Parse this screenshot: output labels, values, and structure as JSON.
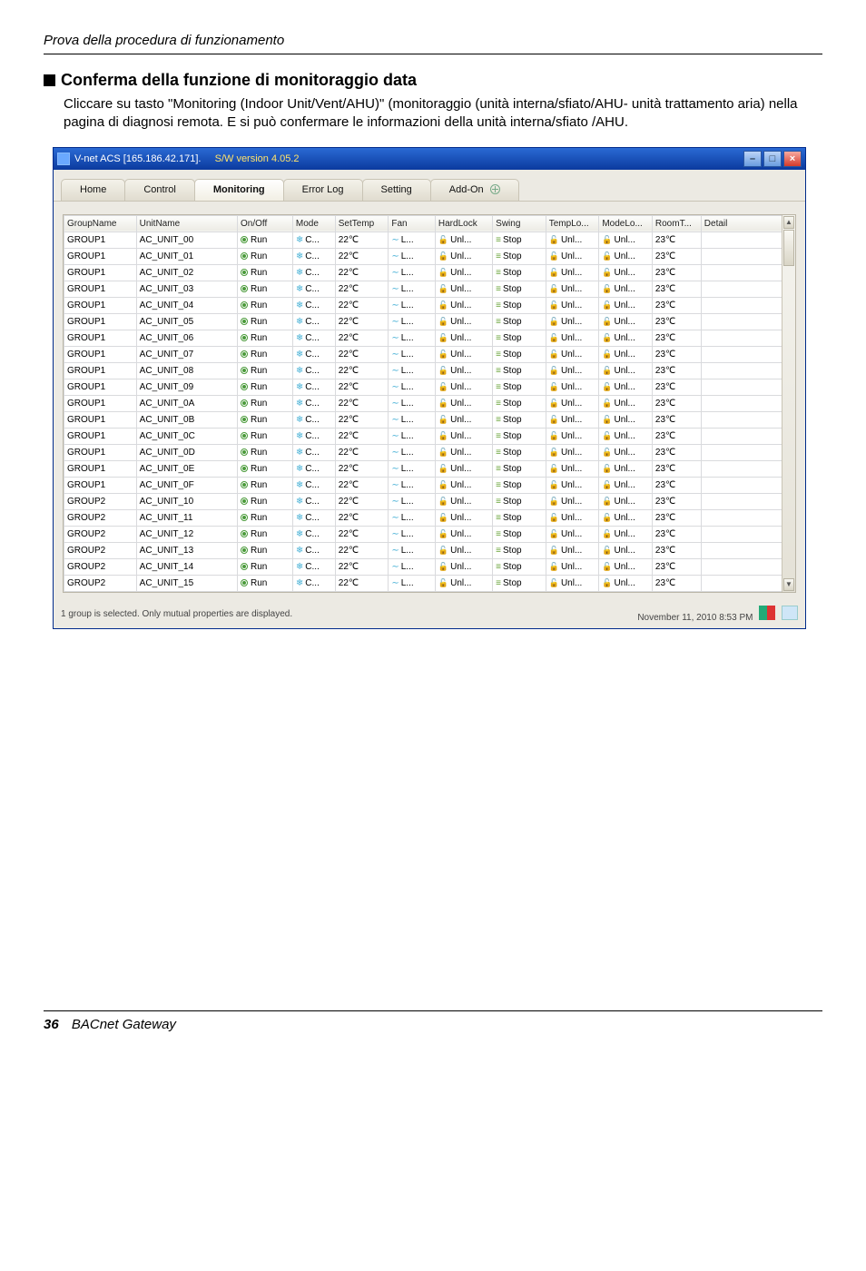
{
  "header": "Prova della procedura di funzionamento",
  "section_title": "Conferma della funzione di monitoraggio data",
  "body_text": "Cliccare su tasto \"Monitoring (Indoor Unit/Vent/AHU)\" (monitoraggio (unità interna/sfiato/AHU- unità trattamento aria) nella pagina di diagnosi remota. E si può confermare le informazioni della unità interna/sfiato /AHU.",
  "window": {
    "title_prefix": "V-net ACS [165.186.42.171].   ",
    "sw_version": "S/W version 4.05.2",
    "tabs": [
      "Home",
      "Control",
      "Monitoring",
      "Error Log",
      "Setting",
      "Add-On"
    ],
    "active_tab": 2,
    "columns": [
      "GroupName",
      "UnitName",
      "On/Off",
      "Mode",
      "SetTemp",
      "Fan",
      "HardLock",
      "Swing",
      "TempLo...",
      "ModeLo...",
      "RoomT...",
      "Detail"
    ],
    "row_template": {
      "onoff": "Run",
      "mode": "C...",
      "settemp": "22℃",
      "fan": "L...",
      "hard": "Unl...",
      "swing": "Stop",
      "tlo": "Unl...",
      "mlo": "Unl...",
      "roomt": "23℃",
      "detail": ""
    },
    "rows": [
      {
        "group": "GROUP1",
        "unit": "AC_UNIT_00"
      },
      {
        "group": "GROUP1",
        "unit": "AC_UNIT_01"
      },
      {
        "group": "GROUP1",
        "unit": "AC_UNIT_02"
      },
      {
        "group": "GROUP1",
        "unit": "AC_UNIT_03"
      },
      {
        "group": "GROUP1",
        "unit": "AC_UNIT_04"
      },
      {
        "group": "GROUP1",
        "unit": "AC_UNIT_05"
      },
      {
        "group": "GROUP1",
        "unit": "AC_UNIT_06"
      },
      {
        "group": "GROUP1",
        "unit": "AC_UNIT_07"
      },
      {
        "group": "GROUP1",
        "unit": "AC_UNIT_08"
      },
      {
        "group": "GROUP1",
        "unit": "AC_UNIT_09"
      },
      {
        "group": "GROUP1",
        "unit": "AC_UNIT_0A"
      },
      {
        "group": "GROUP1",
        "unit": "AC_UNIT_0B"
      },
      {
        "group": "GROUP1",
        "unit": "AC_UNIT_0C"
      },
      {
        "group": "GROUP1",
        "unit": "AC_UNIT_0D"
      },
      {
        "group": "GROUP1",
        "unit": "AC_UNIT_0E"
      },
      {
        "group": "GROUP1",
        "unit": "AC_UNIT_0F"
      },
      {
        "group": "GROUP2",
        "unit": "AC_UNIT_10"
      },
      {
        "group": "GROUP2",
        "unit": "AC_UNIT_11"
      },
      {
        "group": "GROUP2",
        "unit": "AC_UNIT_12"
      },
      {
        "group": "GROUP2",
        "unit": "AC_UNIT_13"
      },
      {
        "group": "GROUP2",
        "unit": "AC_UNIT_14"
      },
      {
        "group": "GROUP2",
        "unit": "AC_UNIT_15"
      }
    ],
    "status_left": "1 group is selected. Only mutual properties are displayed.",
    "status_right": "November 11, 2010  8:53 PM"
  },
  "footer": {
    "page": "36",
    "title": "BACnet Gateway"
  },
  "glyph": {
    "fan": "〰",
    "mode": "❄",
    "lock": "🔓",
    "swing": "≡",
    "tilde": "∼"
  }
}
